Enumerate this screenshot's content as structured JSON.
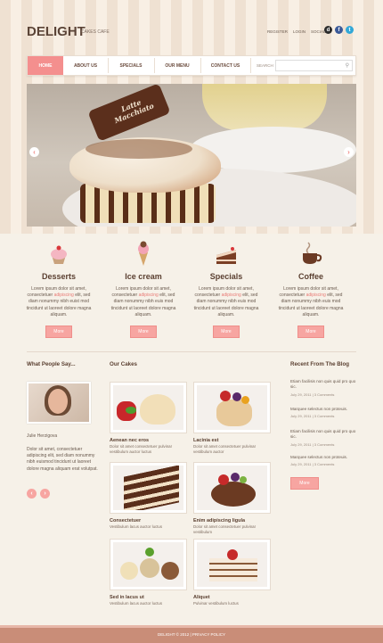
{
  "header": {
    "logo": "DELIGHT",
    "tagline": "CAKES CAFE",
    "links": [
      "REGISTER",
      "LOGIN",
      "SOCIAL"
    ],
    "social_icons": [
      "delicious-icon",
      "facebook-icon",
      "twitter-icon"
    ]
  },
  "nav": {
    "items": [
      "HOME",
      "ABOUT US",
      "SPECIALS",
      "OUR MENU",
      "CONTACT US"
    ],
    "search_label": "SEARCH",
    "search_placeholder": ""
  },
  "hero": {
    "chocolate_text": "Latte Macchiato",
    "left_arrow": "‹",
    "right_arrow": "›"
  },
  "features": [
    {
      "title": "Desserts",
      "text_a": "Lorem ipsum dolor sit amet, consectetuer ",
      "highlight": "adipiscing",
      "text_b": " elit, sed diam nonummy nibh euist mod tincidunt ut laoreet dolore magna aliquam.",
      "button": "More"
    },
    {
      "title": "Ice cream",
      "text_a": "Lorem ipsum dolor sit amet, consectetuer ",
      "highlight": "adipiscing",
      "text_b": " elit, sed diam nonummy nibh euis mod tincidunt ut laoreet dolore magna aliquam.",
      "button": "More"
    },
    {
      "title": "Specials",
      "text_a": "Lorem ipsum dolor sit amet, consectetuer ",
      "highlight": "adipiscing",
      "text_b": " elit, sed diam nonummy nibh euis mod tincidunt ut laoreet dolore magna aliquam.",
      "button": "More"
    },
    {
      "title": "Coffee",
      "text_a": "Lorem ipsum dolor sit amet, consectetuer ",
      "highlight": "adipiscing",
      "text_b": " elit, sed diam nonummy nibh euis mod tincidunt ut laoreet dolore magna aliquam.",
      "button": "More"
    }
  ],
  "testimonials": {
    "title": "What  People Say...",
    "name": "Julie Herzigova",
    "quote": "Dolor sit amet, consectetuer adipiscing elit, sed diam nonummy nibh euismod tincidunt ut laoreet dolore magna aliquam erat volutpat.",
    "prev": "‹",
    "next": "›"
  },
  "cakes": {
    "title": "Our Cakes",
    "items": [
      {
        "name": "Aenean nec eros",
        "desc": "Dolor sit amet consectetuer pulvinar vestibulum auctor luctus"
      },
      {
        "name": "Lacinia est",
        "desc": "Dolor sit amet consectetuer pulvinar vestibulum auctor"
      },
      {
        "name": "Consectetuer",
        "desc": "Vestibulum lacus auctor luctus"
      },
      {
        "name": "Enim adipiscing ligula",
        "desc": "Dolor sit amet consectetuer pulvinar vestibulum"
      },
      {
        "name": "Sed in lacus ut",
        "desc": "Vestibulum lacus auctor luctus"
      },
      {
        "name": "Aliquet",
        "desc": "Pulvinar vestibulum luctus"
      }
    ]
  },
  "blog": {
    "title": "Recent From The Blog",
    "items": [
      {
        "title": "Etiam facilisis non quis quid pro quo sic.",
        "meta": "July 29, 2011  |  3 Comments"
      },
      {
        "title": "Marquee selectus non proteuis.",
        "meta": "July 29, 2011  |  3 Comments"
      },
      {
        "title": "Etiam facilisis non quis quid pro quo sic.",
        "meta": "July 29, 2011  |  3 Comments"
      },
      {
        "title": "Marquee selectus non proteuis.",
        "meta": "July 29, 2011  |  3 Comments"
      }
    ],
    "button": "More"
  },
  "footer": {
    "text": "DELIGHT © 2012  |  PRIVACY POLICY"
  }
}
